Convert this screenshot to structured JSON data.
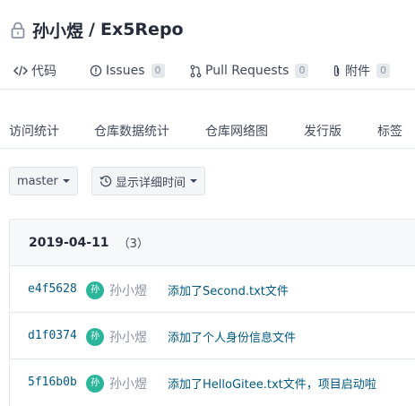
{
  "repo": {
    "owner": "孙小煜",
    "separator": "/",
    "name": "Ex5Repo"
  },
  "tabs": [
    {
      "label": "代码",
      "icon": "code-icon"
    },
    {
      "label": "Issues",
      "icon": "issue-icon",
      "count": "0"
    },
    {
      "label": "Pull Requests",
      "icon": "pull-request-icon",
      "count": "0"
    },
    {
      "label": "附件",
      "icon": "paperclip-icon",
      "count": "0"
    }
  ],
  "subtabs": [
    "访问统计",
    "仓库数据统计",
    "仓库网络图",
    "发行版",
    "标签"
  ],
  "branch_selector": {
    "label": "master"
  },
  "time_toggle": {
    "label": "显示详细时间",
    "icon": "history-icon"
  },
  "commit_group": {
    "date": "2019-04-11",
    "count": "（3）",
    "commits": [
      {
        "sha": "e4f5628",
        "avatar": "孙",
        "author": "孙小煜",
        "message": "添加了Second.txt文件"
      },
      {
        "sha": "d1f0374",
        "avatar": "孙",
        "author": "孙小煜",
        "message": "添加了个人身份信息文件"
      },
      {
        "sha": "5f16b0b",
        "avatar": "孙",
        "author": "孙小煜",
        "message": "添加了HelloGitee.txt文件，项目启动啦"
      }
    ]
  }
}
